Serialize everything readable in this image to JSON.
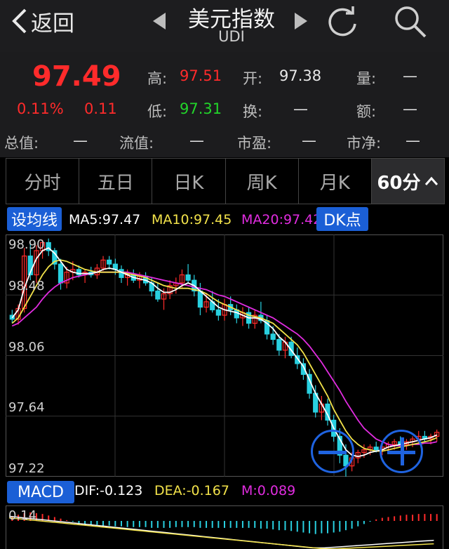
{
  "header": {
    "back_label": "返回",
    "title": "美元指数",
    "subtitle": "UDI"
  },
  "quote": {
    "price": "97.49",
    "change_pct": "0.11%",
    "change": "0.11",
    "high_label": "高:",
    "high": "97.51",
    "open_label": "开:",
    "open": "97.38",
    "volume_label": "量:",
    "volume": "—",
    "low_label": "低:",
    "low": "97.31",
    "turnover_label": "换:",
    "turnover": "—",
    "amount_label": "额:",
    "amount": "—",
    "total_value_label": "总值:",
    "total_value": "—",
    "float_value_label": "流值:",
    "float_value": "—",
    "pe_label": "市盈:",
    "pe": "—",
    "pb_label": "市净:",
    "pb": "—"
  },
  "tabs": [
    "分时",
    "五日",
    "日K",
    "周K",
    "月K",
    "60分"
  ],
  "indicators": {
    "set_ma_button": "设均线",
    "ma5": "MA5:97.47",
    "ma10": "MA10:97.45",
    "ma20": "MA20:97.42",
    "dk_button": "DK点"
  },
  "colors": {
    "up": "#ff2b2b",
    "down": "#29d0e0",
    "ma5": "#ffffff",
    "ma10": "#f2e24a",
    "ma20": "#e12ce0",
    "accent": "#1b5fd6",
    "low_green": "#22d42a"
  },
  "chart_data": {
    "type": "candlestick",
    "y_ticks": [
      "98.90",
      "98.48",
      "98.06",
      "97.64",
      "97.22"
    ],
    "ylim": [
      97.16,
      98.96
    ],
    "candles": [
      [
        98.36,
        98.4,
        98.3,
        98.33
      ],
      [
        98.33,
        98.44,
        98.29,
        98.41
      ],
      [
        98.41,
        98.86,
        98.38,
        98.8
      ],
      [
        98.8,
        98.9,
        98.62,
        98.66
      ],
      [
        98.66,
        98.88,
        98.6,
        98.84
      ],
      [
        98.84,
        98.92,
        98.78,
        98.9
      ],
      [
        98.9,
        98.93,
        98.8,
        98.84
      ],
      [
        98.84,
        98.86,
        98.7,
        98.74
      ],
      [
        98.74,
        98.78,
        98.55,
        98.6
      ],
      [
        98.6,
        98.72,
        98.56,
        98.68
      ],
      [
        98.68,
        98.76,
        98.62,
        98.7
      ],
      [
        98.7,
        98.73,
        98.64,
        98.66
      ],
      [
        98.66,
        98.7,
        98.6,
        98.68
      ],
      [
        98.68,
        98.72,
        98.64,
        98.66
      ],
      [
        98.66,
        98.74,
        98.63,
        98.71
      ],
      [
        98.71,
        98.8,
        98.69,
        98.77
      ],
      [
        98.77,
        98.8,
        98.7,
        98.74
      ],
      [
        98.74,
        98.78,
        98.66,
        98.7
      ],
      [
        98.7,
        98.73,
        98.6,
        98.64
      ],
      [
        98.64,
        98.7,
        98.58,
        98.66
      ],
      [
        98.66,
        98.7,
        98.6,
        98.62
      ],
      [
        98.62,
        98.68,
        98.56,
        98.65
      ],
      [
        98.65,
        98.68,
        98.58,
        98.6
      ],
      [
        98.6,
        98.64,
        98.5,
        98.54
      ],
      [
        98.54,
        98.6,
        98.46,
        98.48
      ],
      [
        98.48,
        98.56,
        98.4,
        98.52
      ],
      [
        98.52,
        98.62,
        98.48,
        98.58
      ],
      [
        98.58,
        98.64,
        98.52,
        98.6
      ],
      [
        98.6,
        98.7,
        98.56,
        98.66
      ],
      [
        98.66,
        98.74,
        98.6,
        98.62
      ],
      [
        98.62,
        98.66,
        98.5,
        98.54
      ],
      [
        98.54,
        98.6,
        98.36,
        98.42
      ],
      [
        98.42,
        98.52,
        98.38,
        98.46
      ],
      [
        98.46,
        98.54,
        98.38,
        98.4
      ],
      [
        98.4,
        98.48,
        98.32,
        98.36
      ],
      [
        98.36,
        98.48,
        98.32,
        98.44
      ],
      [
        98.44,
        98.5,
        98.36,
        98.4
      ],
      [
        98.4,
        98.44,
        98.3,
        98.34
      ],
      [
        98.34,
        98.42,
        98.28,
        98.38
      ],
      [
        98.38,
        98.42,
        98.26,
        98.3
      ],
      [
        98.3,
        98.4,
        98.26,
        98.36
      ],
      [
        98.36,
        98.46,
        98.3,
        98.32
      ],
      [
        98.32,
        98.36,
        98.18,
        98.22
      ],
      [
        98.22,
        98.28,
        98.14,
        98.18
      ],
      [
        98.18,
        98.22,
        98.06,
        98.1
      ],
      [
        98.1,
        98.2,
        98.04,
        98.16
      ],
      [
        98.16,
        98.2,
        98.04,
        98.06
      ],
      [
        98.06,
        98.12,
        97.96,
        98.0
      ],
      [
        98.0,
        98.04,
        97.88,
        97.92
      ],
      [
        97.92,
        97.96,
        97.74,
        97.78
      ],
      [
        97.78,
        97.84,
        97.6,
        97.64
      ],
      [
        97.64,
        97.76,
        97.58,
        97.7
      ],
      [
        97.7,
        97.74,
        97.54,
        97.58
      ],
      [
        97.58,
        97.62,
        97.42,
        97.46
      ],
      [
        97.46,
        97.52,
        97.26,
        97.32
      ],
      [
        97.32,
        97.4,
        97.16,
        97.24
      ],
      [
        97.24,
        97.34,
        97.2,
        97.3
      ],
      [
        97.3,
        97.36,
        97.26,
        97.34
      ],
      [
        97.34,
        97.4,
        97.3,
        97.36
      ],
      [
        97.36,
        97.4,
        97.32,
        97.38
      ],
      [
        97.38,
        97.42,
        97.34,
        97.36
      ],
      [
        97.36,
        97.4,
        97.32,
        97.38
      ],
      [
        97.38,
        97.42,
        97.34,
        97.4
      ],
      [
        97.4,
        97.44,
        97.36,
        97.42
      ],
      [
        97.42,
        97.46,
        97.38,
        97.4
      ],
      [
        97.4,
        97.44,
        97.36,
        97.42
      ],
      [
        97.42,
        97.46,
        97.38,
        97.44
      ],
      [
        97.44,
        97.5,
        97.4,
        97.46
      ],
      [
        97.46,
        97.5,
        97.42,
        97.44
      ],
      [
        97.44,
        97.48,
        97.4,
        97.46
      ],
      [
        97.46,
        97.51,
        97.42,
        97.49
      ]
    ],
    "ma5_points": [
      98.34,
      98.4,
      98.56,
      98.68,
      98.78,
      98.84,
      98.86,
      98.82,
      98.76,
      98.7,
      98.68,
      98.67,
      98.67,
      98.67,
      98.68,
      98.7,
      98.71,
      98.7,
      98.68,
      98.66,
      98.64,
      98.63,
      98.62,
      98.6,
      98.56,
      98.53,
      98.53,
      98.55,
      98.58,
      98.6,
      98.58,
      98.54,
      98.5,
      98.46,
      98.42,
      98.4,
      98.39,
      98.38,
      98.36,
      98.34,
      98.34,
      98.33,
      98.3,
      98.26,
      98.2,
      98.16,
      98.1,
      98.04,
      97.98,
      97.88,
      97.78,
      97.7,
      97.62,
      97.52,
      97.44,
      97.36,
      97.32,
      97.31,
      97.32,
      97.34,
      97.35,
      97.36,
      97.38,
      97.39,
      97.4,
      97.41,
      97.42,
      97.43,
      97.44,
      97.45,
      97.47
    ],
    "ma10_points": [
      98.3,
      98.34,
      98.42,
      98.5,
      98.58,
      98.66,
      98.72,
      98.76,
      98.77,
      98.76,
      98.74,
      98.72,
      98.7,
      98.69,
      98.68,
      98.68,
      98.68,
      98.68,
      98.68,
      98.67,
      98.66,
      98.65,
      98.64,
      98.62,
      98.6,
      98.58,
      98.57,
      98.56,
      98.56,
      98.56,
      98.55,
      98.54,
      98.52,
      98.49,
      98.46,
      98.44,
      98.42,
      98.4,
      98.38,
      98.36,
      98.35,
      98.34,
      98.32,
      98.3,
      98.26,
      98.22,
      98.18,
      98.14,
      98.08,
      98.0,
      97.92,
      97.84,
      97.76,
      97.66,
      97.58,
      97.5,
      97.44,
      97.4,
      97.37,
      97.36,
      97.35,
      97.35,
      97.36,
      97.37,
      97.38,
      97.39,
      97.4,
      97.41,
      97.42,
      97.43,
      97.45
    ],
    "ma20_points": [
      98.28,
      98.3,
      98.34,
      98.38,
      98.42,
      98.48,
      98.53,
      98.57,
      98.6,
      98.62,
      98.64,
      98.65,
      98.66,
      98.67,
      98.68,
      98.68,
      98.68,
      98.68,
      98.68,
      98.68,
      98.67,
      98.66,
      98.65,
      98.64,
      98.63,
      98.62,
      98.61,
      98.6,
      98.59,
      98.58,
      98.57,
      98.56,
      98.55,
      98.53,
      98.51,
      98.5,
      98.48,
      98.46,
      98.44,
      98.42,
      98.4,
      98.38,
      98.36,
      98.34,
      98.31,
      98.28,
      98.25,
      98.22,
      98.18,
      98.13,
      98.07,
      98.01,
      97.94,
      97.87,
      97.8,
      97.72,
      97.65,
      97.58,
      97.52,
      97.48,
      97.44,
      97.42,
      97.4,
      97.39,
      97.39,
      97.39,
      97.4,
      97.4,
      97.41,
      97.41,
      97.42
    ],
    "macd": {
      "dif": "DIF:-0.123",
      "dea": "DEA:-0.167",
      "m": "M:0.089",
      "top_tick": "0.14",
      "bars": [
        0.05,
        0.08,
        0.1,
        0.11,
        0.1,
        0.09,
        0.07,
        0.05,
        0.03,
        0.01,
        -0.01,
        -0.03,
        -0.04,
        -0.05,
        -0.05,
        -0.06,
        -0.06,
        -0.07,
        -0.07,
        -0.08,
        -0.08,
        -0.08,
        -0.08,
        -0.09,
        -0.09,
        -0.09,
        -0.09,
        -0.08,
        -0.08,
        -0.08,
        -0.08,
        -0.09,
        -0.09,
        -0.09,
        -0.09,
        -0.09,
        -0.09,
        -0.09,
        -0.09,
        -0.09,
        -0.09,
        -0.1,
        -0.1,
        -0.11,
        -0.12,
        -0.12,
        -0.13,
        -0.14,
        -0.15,
        -0.16,
        -0.17,
        -0.16,
        -0.16,
        -0.15,
        -0.14,
        -0.12,
        -0.1,
        -0.07,
        -0.04,
        -0.01,
        0.02,
        0.04,
        0.05,
        0.06,
        0.07,
        0.08,
        0.08,
        0.09,
        0.09,
        0.09,
        0.089
      ]
    }
  },
  "macd_button": "MACD"
}
